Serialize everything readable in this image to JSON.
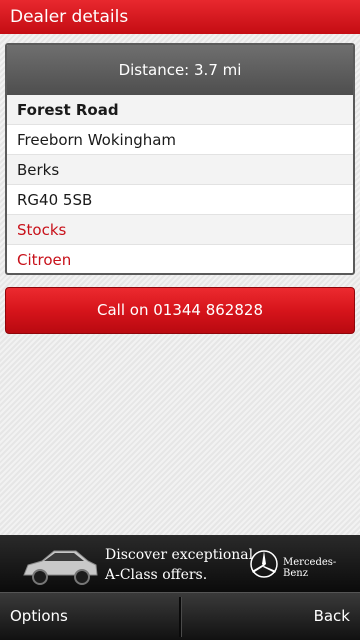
{
  "header": {
    "title": "Dealer details"
  },
  "dealer": {
    "distance": "Distance: 3.7 mi",
    "address_line1": "Forest Road",
    "address_line2": "Freeborn Wokingham",
    "address_line3": "Berks",
    "postcode": "RG40 5SB",
    "link_stocks": "Stocks",
    "link_brand": "Citroen"
  },
  "actions": {
    "call_label": "Call on 01344 862828"
  },
  "ad": {
    "line1": "Discover exceptional",
    "line2": "A-Class offers.",
    "brand": "Mercedes-Benz"
  },
  "softkeys": {
    "left": "Options",
    "right": "Back"
  },
  "colors": {
    "accent": "#d6141b",
    "link": "#c8111a",
    "header_bg": "#5a5a5a"
  }
}
